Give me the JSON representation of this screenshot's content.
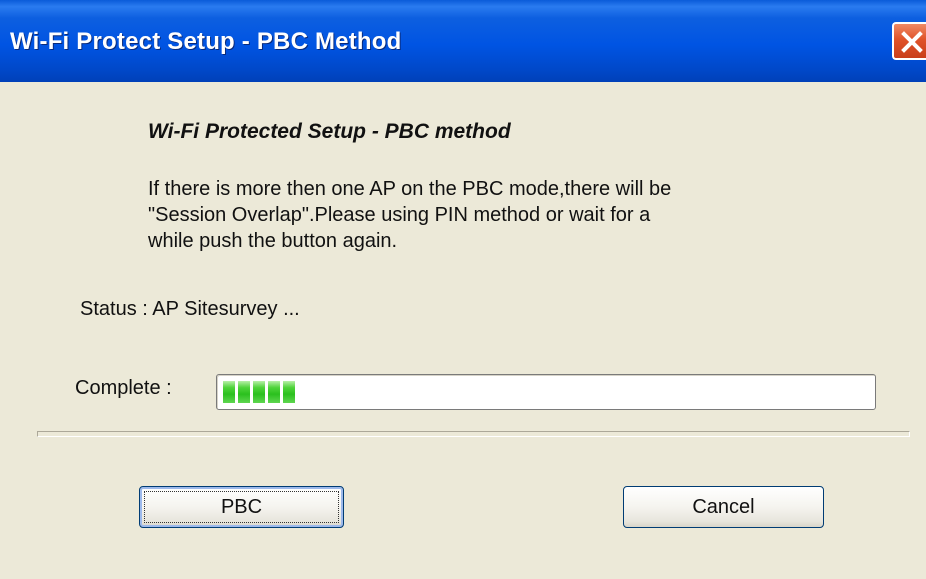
{
  "window": {
    "title": "Wi-Fi Protect Setup - PBC Method"
  },
  "content": {
    "heading": "Wi-Fi Protected Setup - PBC method",
    "description_lines": [
      "If there is more then one AP on the PBC mode,there will be",
      "\"Session Overlap\".Please using PIN method or wait for a",
      "while push the button again."
    ],
    "status_text": "Status : AP Sitesurvey ...",
    "complete_label": "Complete :",
    "progress": {
      "segments_filled": 5,
      "color": "#2bc01e"
    }
  },
  "buttons": {
    "pbc_label": "PBC",
    "cancel_label": "Cancel"
  },
  "icons": {
    "close": "close-icon"
  },
  "colors": {
    "titlebar": "#0054e3",
    "close_button": "#e0532a",
    "background": "#ece9d8"
  }
}
